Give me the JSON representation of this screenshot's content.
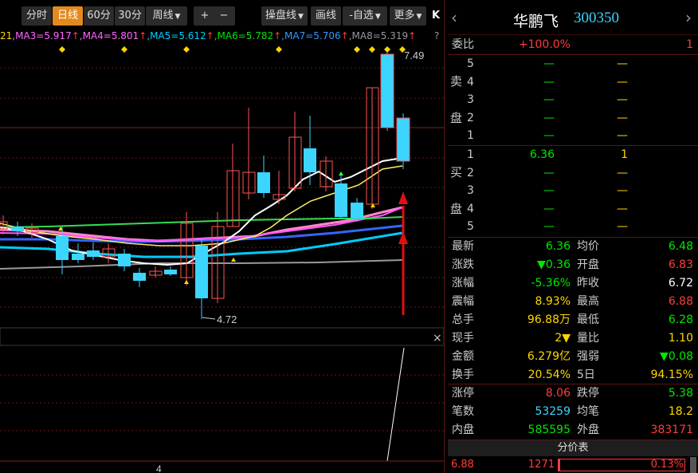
{
  "toolbar": {
    "tabs": [
      {
        "label": "分时",
        "active": false
      },
      {
        "label": "日线",
        "active": true
      },
      {
        "label": "60分",
        "active": false
      },
      {
        "label": "30分",
        "active": false
      },
      {
        "label": "周线",
        "active": false
      }
    ],
    "plus": "+",
    "minus": "−",
    "draw_toolbar": "操盘线",
    "draw": "画线",
    "watchlist": "-自选",
    "more": "更多",
    "collapse": "K"
  },
  "ma_legend": [
    {
      "text": "21",
      "color": "#ffd700"
    },
    {
      "text": ",MA3=5.917",
      "color": "#ff66ff"
    },
    {
      "text": "↑",
      "color": "#ff3c3c"
    },
    {
      "text": ",MA4=5.801",
      "color": "#ff66ff"
    },
    {
      "text": "↑",
      "color": "#ff3c3c"
    },
    {
      "text": ",MA5=5.612",
      "color": "#00ccff"
    },
    {
      "text": "↑",
      "color": "#ff3c3c"
    },
    {
      "text": ",MA6=5.782",
      "color": "#00e600"
    },
    {
      "text": "↑",
      "color": "#ff3c3c"
    },
    {
      "text": ",MA7=5.706",
      "color": "#3399ff"
    },
    {
      "text": "↑",
      "color": "#ff3c3c"
    },
    {
      "text": ",MA8=5.319",
      "color": "#999999"
    },
    {
      "text": "↑",
      "color": "#ff3c3c"
    },
    {
      "text": "?",
      "color": "#999999"
    }
  ],
  "chart": {
    "high_label": "7.49",
    "low_label": "4.72",
    "volume_label": "4",
    "close_button": "×"
  },
  "stock": {
    "name": "华鹏飞",
    "code": "300350"
  },
  "committee": {
    "label": "委比",
    "ratio": "+100.0%",
    "diff": "1"
  },
  "sell_side": {
    "label_top": "卖",
    "label_bottom": "盘",
    "levels": [
      {
        "level": "5",
        "price": "—",
        "volume": "—"
      },
      {
        "level": "4",
        "price": "—",
        "volume": "—"
      },
      {
        "level": "3",
        "price": "—",
        "volume": "—"
      },
      {
        "level": "2",
        "price": "—",
        "volume": "—"
      },
      {
        "level": "1",
        "price": "—",
        "volume": "—"
      }
    ]
  },
  "buy_side": {
    "label_top": "买",
    "label_bottom": "盘",
    "levels": [
      {
        "level": "1",
        "price": "6.36",
        "volume": "1"
      },
      {
        "level": "2",
        "price": "—",
        "volume": "—"
      },
      {
        "level": "3",
        "price": "—",
        "volume": "—"
      },
      {
        "level": "4",
        "price": "—",
        "volume": "—"
      },
      {
        "level": "5",
        "price": "—",
        "volume": "—"
      }
    ]
  },
  "quote": [
    {
      "l1": "最新",
      "v1": "6.36",
      "c1": "#00e600",
      "l2": "均价",
      "v2": "6.48",
      "c2": "#00e600"
    },
    {
      "l1": "涨跌",
      "v1": "▼0.36",
      "c1": "#00e600",
      "l2": "开盘",
      "v2": "6.83",
      "c2": "#ff3c3c"
    },
    {
      "l1": "涨幅",
      "v1": "-5.36%",
      "c1": "#00e600",
      "l2": "昨收",
      "v2": "6.72",
      "c2": "#ffffff"
    },
    {
      "l1": "震幅",
      "v1": "8.93%",
      "c1": "#ffd700",
      "l2": "最高",
      "v2": "6.88",
      "c2": "#ff3c3c"
    },
    {
      "l1": "总手",
      "v1": "96.88万",
      "c1": "#ffd700",
      "l2": "最低",
      "v2": "6.28",
      "c2": "#00e600"
    },
    {
      "l1": "现手",
      "v1": "2▼",
      "c1": "#ffd700",
      "l2": "量比",
      "v2": "1.10",
      "c2": "#ffd700"
    },
    {
      "l1": "金额",
      "v1": "6.279亿",
      "c1": "#ffd700",
      "l2": "强弱",
      "v2": "▼0.08",
      "c2": "#00e600"
    },
    {
      "l1": "换手",
      "v1": "20.54%",
      "c1": "#ffd700",
      "l2": "5日",
      "v2": "94.15%",
      "c2": "#ffd700"
    }
  ],
  "limits": [
    {
      "l1": "涨停",
      "v1": "8.06",
      "c1": "#ff3c3c",
      "l2": "跌停",
      "v2": "5.38",
      "c2": "#00e600"
    },
    {
      "l1": "笔数",
      "v1": "53259",
      "c1": "#3cd5ff",
      "l2": "均笔",
      "v2": "18.2",
      "c2": "#ffd700"
    },
    {
      "l1": "内盘",
      "v1": "585595",
      "c1": "#00e600",
      "l2": "外盘",
      "v2": "383171",
      "c2": "#ff3c3c"
    }
  ],
  "price_table": {
    "title": "分价表",
    "rows": [
      {
        "price": "6.88",
        "volume": "1271",
        "pct": "0.13%",
        "pct_value": 0.13
      }
    ]
  }
}
